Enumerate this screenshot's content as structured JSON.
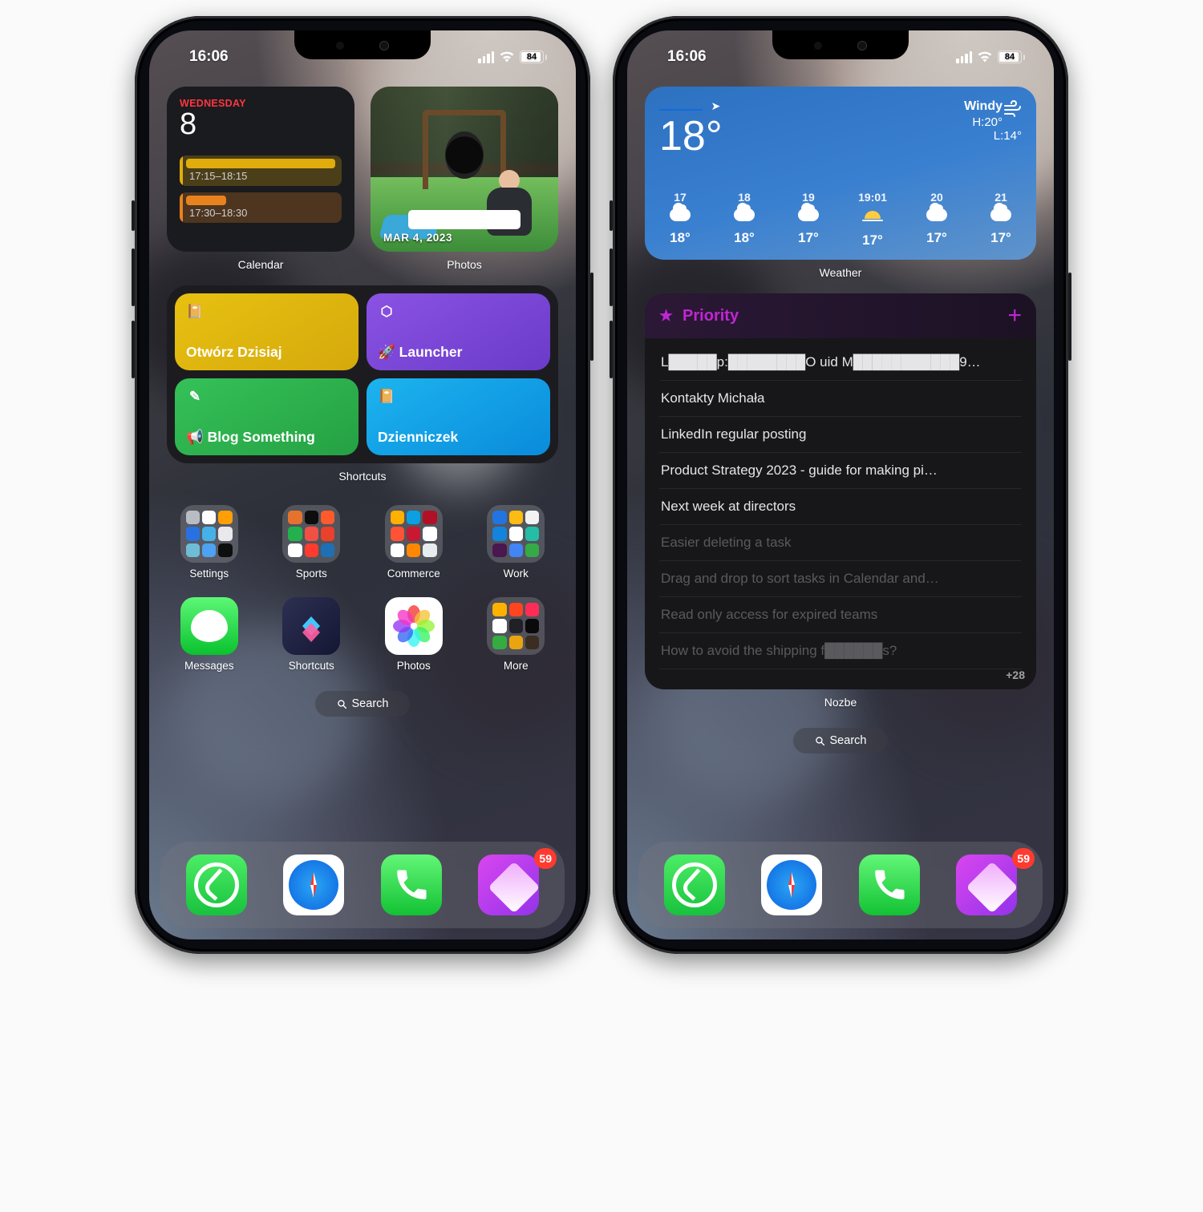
{
  "status": {
    "time": "16:06",
    "battery": "84"
  },
  "left": {
    "calendar": {
      "label": "Calendar",
      "day_of_week": "WEDNESDAY",
      "day_number": "8",
      "event1_time": "17:15–18:15",
      "event2_time": "17:30–18:30"
    },
    "photos": {
      "label": "Photos",
      "date": "MAR 4, 2023"
    },
    "shortcuts": {
      "label": "Shortcuts",
      "items": [
        {
          "label": "Otwórz Dzisiaj",
          "icon": "📔",
          "color": "sc-y"
        },
        {
          "label": "🚀 Launcher",
          "icon": "⬡",
          "color": "sc-p"
        },
        {
          "label": "📢 Blog Something",
          "icon": "✎",
          "color": "sc-g"
        },
        {
          "label": "Dzienniczek",
          "icon": "📔",
          "color": "sc-b"
        }
      ]
    },
    "folders": [
      "Settings",
      "Sports",
      "Commerce",
      "Work"
    ],
    "apps_row": [
      "Messages",
      "Shortcuts",
      "Photos",
      "More"
    ]
  },
  "right": {
    "weather": {
      "label": "Weather",
      "temp": "18°",
      "condition": "Windy",
      "high": "H:20°",
      "low": "L:14°",
      "hours": [
        {
          "h": "17",
          "t": "18°",
          "icon": "cloud"
        },
        {
          "h": "18",
          "t": "18°",
          "icon": "cloud"
        },
        {
          "h": "19",
          "t": "17°",
          "icon": "cloud"
        },
        {
          "h": "19:01",
          "t": "17°",
          "icon": "sunset"
        },
        {
          "h": "20",
          "t": "17°",
          "icon": "cloud"
        },
        {
          "h": "21",
          "t": "17°",
          "icon": "cloud"
        }
      ]
    },
    "nozbe": {
      "label": "Nozbe",
      "title": "Priority",
      "more": "+28",
      "items": [
        {
          "text": "L█████p:████████O uid M███████████9…",
          "dim": false
        },
        {
          "text": "Kontakty Michała",
          "dim": false
        },
        {
          "text": "LinkedIn regular posting",
          "dim": false
        },
        {
          "text": "Product Strategy 2023 - guide for making pi…",
          "dim": false
        },
        {
          "text": "Next week at directors",
          "dim": false
        },
        {
          "text": "Easier deleting a task",
          "dim": true
        },
        {
          "text": "Drag and drop to sort tasks in Calendar and…",
          "dim": true
        },
        {
          "text": "Read only access for expired teams",
          "dim": true
        },
        {
          "text": "How to avoid the shipping f██████s?",
          "dim": true
        }
      ]
    }
  },
  "search": "Search",
  "dock": {
    "badge": "59",
    "apps": [
      "WhatsApp",
      "Safari",
      "Phone",
      "Nozbe"
    ]
  },
  "folder_palettes": {
    "Settings": [
      "#b8bcc5",
      "#fefeff",
      "#ff9f05",
      "#2871e3",
      "#46b1e9",
      "#e8e8ed",
      "#6fbcd6",
      "#4da2f3",
      "#0d0f0f"
    ],
    "Sports": [
      "#e5732e",
      "#0e0d0d",
      "#ff5a2b",
      "#22b14c",
      "#f15044",
      "#e9412b",
      "#fff",
      "#ff3b30",
      "#1e6fb4"
    ],
    "Commerce": [
      "#ffb000",
      "#0aa0e1",
      "#b11027",
      "#ff5335",
      "#c81832",
      "#fff",
      "#fff",
      "#ff8800",
      "#e7ecef"
    ],
    "Work": [
      "#2274e0",
      "#fdbb13",
      "#f2f2f2",
      "#1483db",
      "#ffffff",
      "#24bda5",
      "#4b174f",
      "#4285f4",
      "#35aa47"
    ],
    "More": [
      "#ffb100",
      "#ff4420",
      "#ff2d55",
      "#fff",
      "#202027",
      "#0a0a0c",
      "#34ac42",
      "#e9a50f",
      "#3b2d21"
    ]
  }
}
